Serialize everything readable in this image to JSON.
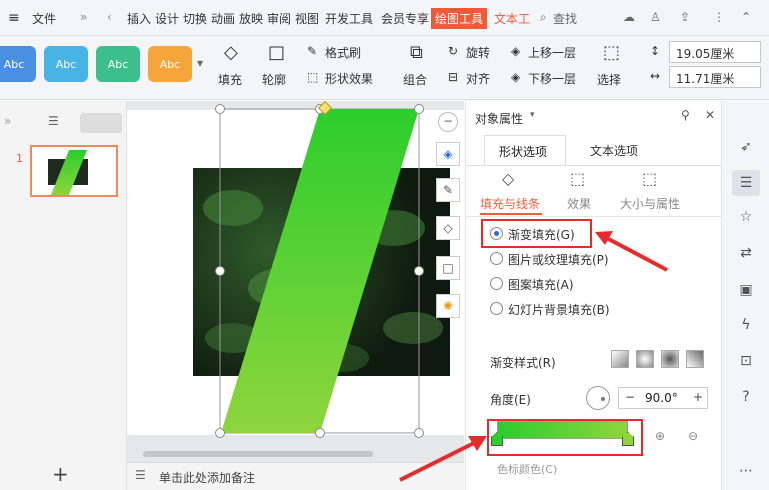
{
  "topbar": {
    "menu_label": "文件",
    "tabs": [
      "插入",
      "设计",
      "切换",
      "动画",
      "放映",
      "审阅",
      "视图",
      "开发工具",
      "会员专享"
    ],
    "active_tab": "绘图工具",
    "text_tools": "文本工",
    "search": "查找"
  },
  "ribbon": {
    "swatches": [
      {
        "label": "Abc",
        "color": "#4a8fe0"
      },
      {
        "label": "Abc",
        "color": "#4ab3e6"
      },
      {
        "label": "Abc",
        "color": "#3cbf8c"
      },
      {
        "label": "Abc",
        "color": "#f5a53a"
      }
    ],
    "fill": "填充",
    "outline": "轮廓",
    "format_painter": "格式刷",
    "shape_effects": "形状效果",
    "group": "组合",
    "rotate": "旋转",
    "align": "对齐",
    "bring_forward": "上移一层",
    "send_backward": "下移一层",
    "select": "选择",
    "width": "19.05厘米",
    "height": "11.71厘米"
  },
  "slides": {
    "number": "1"
  },
  "notes": {
    "placeholder": "单击此处添加备注"
  },
  "props": {
    "title": "对象属性",
    "tabs": {
      "shape": "形状选项",
      "text": "文本选项"
    },
    "subtabs": {
      "fill_line": "填充与线条",
      "effects": "效果",
      "size": "大小与属性"
    },
    "fill_options": [
      "渐变填充(G)",
      "图片或纹理填充(P)",
      "图案填充(A)",
      "幻灯片背景填充(B)"
    ],
    "gradient_style_label": "渐变样式(R)",
    "angle_label": "角度(E)",
    "angle_value": "90.0°",
    "stop_color_label": "色标颜色(C)"
  },
  "colors": {
    "green_top": "#2ccd2c",
    "green_bottom": "#8ed53c",
    "accent": "#f05a3a",
    "highlight": "#e52b2b"
  }
}
